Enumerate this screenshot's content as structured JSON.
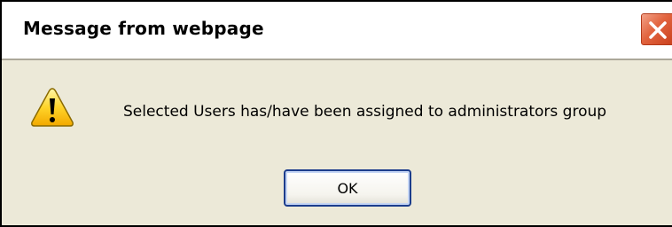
{
  "dialog": {
    "title": "Message from webpage",
    "message": "Selected Users has/have been assigned to administrators group",
    "ok_label": "OK"
  },
  "colors": {
    "dialog_background": "#ece9d8",
    "titlebar_background": "#ffffff",
    "close_button": "#e2643f",
    "ok_button_border": "#1c3d8c",
    "warning_icon_fill": "#ffd42a"
  },
  "icons": {
    "close": "close-icon",
    "warning": "warning-icon"
  }
}
